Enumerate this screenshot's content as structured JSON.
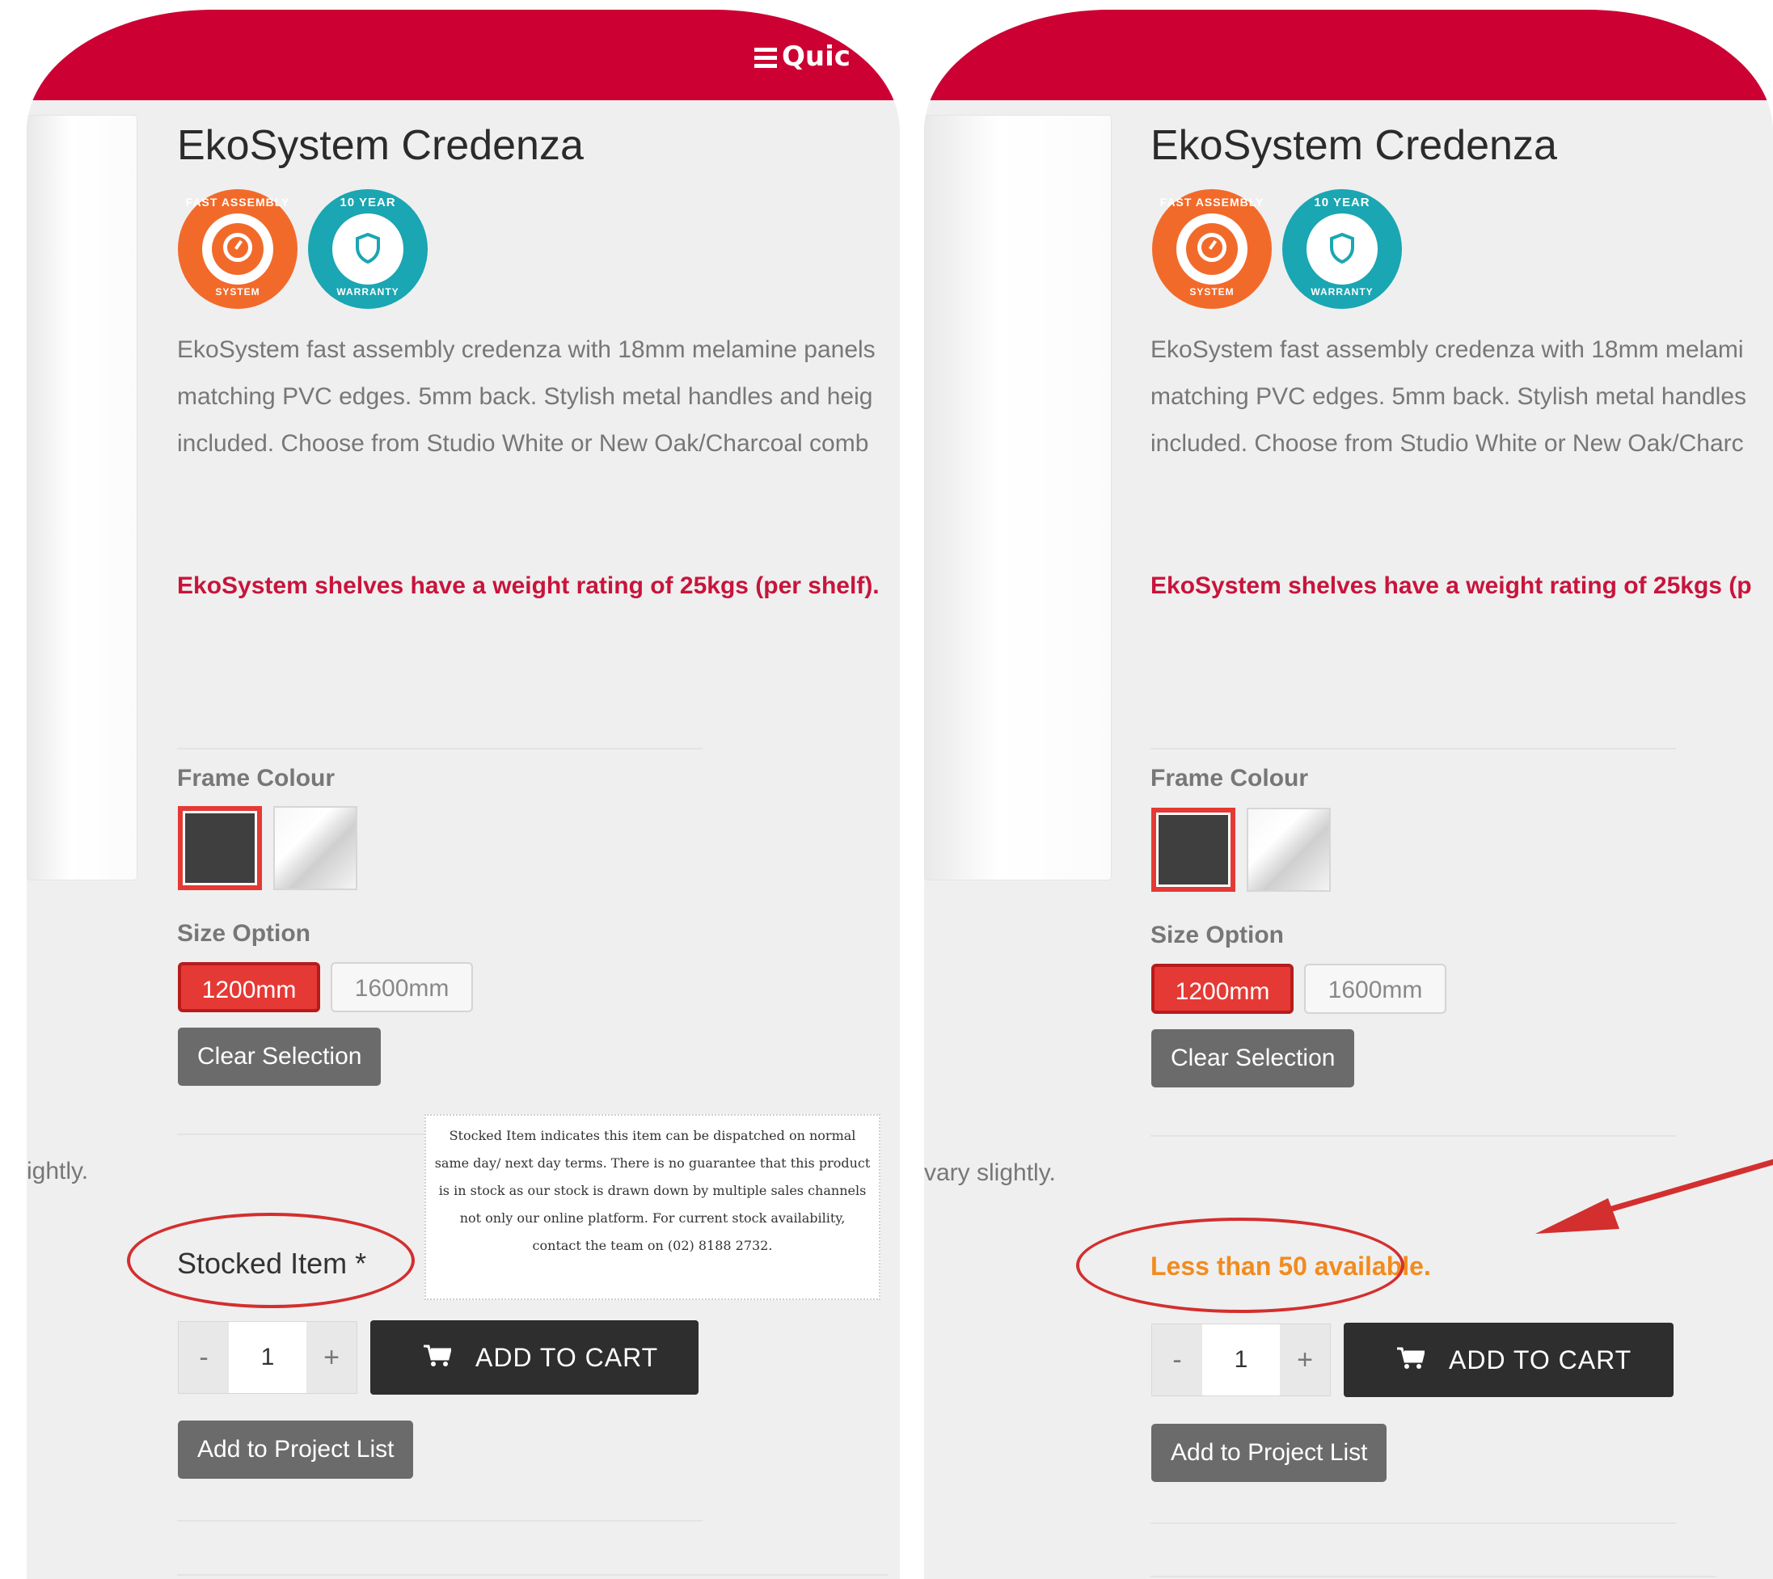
{
  "nav": {
    "quick_label": "Quic"
  },
  "product": {
    "title": "EkoSystem Credenza",
    "badges": [
      {
        "icon": "fast-assembly-icon",
        "text_top": "FAST ASSEMBLY",
        "text_bottom": "SYSTEM"
      },
      {
        "icon": "warranty-shield-icon",
        "text_top": "10 YEAR",
        "text_bottom": "WARRANTY"
      }
    ],
    "description_lines_left": [
      "EkoSystem fast assembly credenza with 18mm melamine panels",
      "matching PVC edges. 5mm back. Stylish metal handles and heig",
      "included. Choose from Studio White or New Oak/Charcoal comb"
    ],
    "description_lines_right": [
      "EkoSystem fast assembly credenza with 18mm melami",
      "matching PVC edges. 5mm back. Stylish metal handles",
      "included. Choose from Studio White or New Oak/Charc"
    ],
    "weight_note_left": "EkoSystem shelves have a weight rating of 25kgs (per shelf).",
    "weight_note_right": "EkoSystem shelves have a weight rating of 25kgs (p",
    "frame_colour_label": "Frame Colour",
    "size_option_label": "Size Option",
    "sizes": [
      "1200mm",
      "1600mm"
    ],
    "selected_size": "1200mm",
    "clear_selection": "Clear Selection",
    "side_text_left": "ightly.",
    "side_text_right": "vary slightly.",
    "stock_left": "Stocked Item *",
    "stock_right": "Less than 50 available.",
    "tooltip": "Stocked Item indicates this item can be dispatched on normal same day/ next day terms. There is no guarantee that this product is in stock as our stock is drawn down by multiple sales channels not only our online platform. For current stock availability, contact the team on (02) 8188 2732.",
    "quantity": "1",
    "qty_minus": "-",
    "qty_plus": "+",
    "add_to_cart": "ADD TO CART",
    "add_to_project": "Add to Project List"
  },
  "colors": {
    "brand_red": "#cc0033",
    "accent_red": "#e53935",
    "stock_orange": "#f28b1e",
    "annotation_red": "#d32f2f"
  }
}
